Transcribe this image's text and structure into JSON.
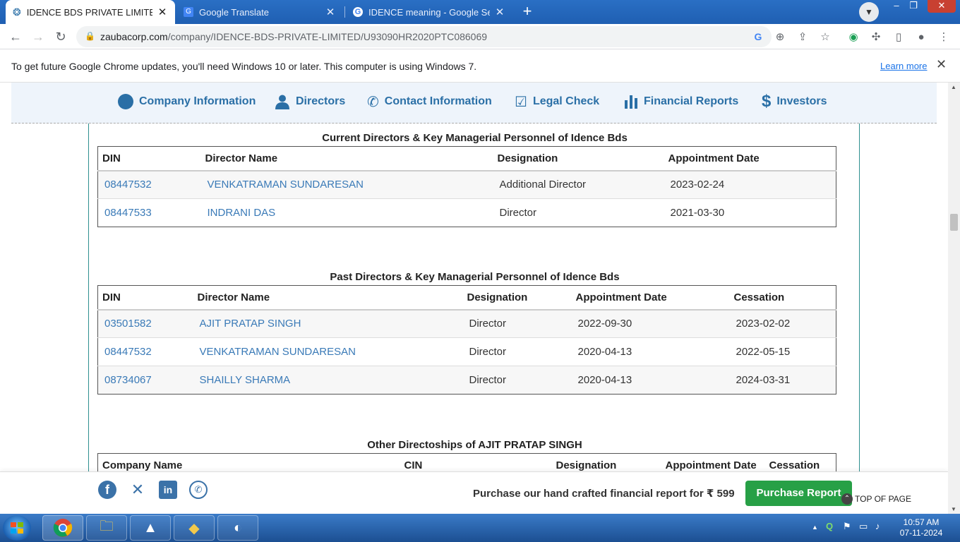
{
  "browser": {
    "tabs": [
      {
        "title": "IDENCE BDS PRIVATE LIMITED | I",
        "icon": "zauba-favicon",
        "active": true
      },
      {
        "title": "Google Translate",
        "icon": "google-translate-favicon",
        "active": false
      },
      {
        "title": "IDENCE meaning - Google Search",
        "icon": "google-favicon",
        "active": false
      }
    ],
    "close_glyph": "✕",
    "new_tab_glyph": "+",
    "url_host": "zaubacorp.com",
    "url_path": "/company/IDENCE-BDS-PRIVATE-LIMITED/U93090HR2020PTC086069"
  },
  "infobar": {
    "message": "To get future Google Chrome updates, you'll need Windows 10 or later. This computer is using Windows 7.",
    "learn_more": "Learn more"
  },
  "company_nav": [
    {
      "label": "Company Information",
      "icon": "info-circle-icon"
    },
    {
      "label": "Directors",
      "icon": "user-icon"
    },
    {
      "label": "Contact Information",
      "icon": "phone-icon"
    },
    {
      "label": "Legal Check",
      "icon": "checkbox-icon"
    },
    {
      "label": "Financial Reports",
      "icon": "bar-chart-icon"
    },
    {
      "label": "Investors",
      "icon": "dollar-icon"
    }
  ],
  "current_directors": {
    "title": "Current Directors & Key Managerial Personnel of Idence Bds",
    "headers": [
      "DIN",
      "Director Name",
      "Designation",
      "Appointment Date"
    ],
    "rows": [
      [
        "08447532",
        "VENKATRAMAN SUNDARESAN",
        "Additional Director",
        "2023-02-24"
      ],
      [
        "08447533",
        "INDRANI DAS",
        "Director",
        "2021-03-30"
      ]
    ]
  },
  "past_directors": {
    "title": "Past Directors & Key Managerial Personnel of Idence Bds",
    "headers": [
      "DIN",
      "Director Name",
      "Designation",
      "Appointment Date",
      "Cessation"
    ],
    "rows": [
      [
        "03501582",
        "AJIT PRATAP SINGH",
        "Director",
        "2022-09-30",
        "2023-02-02"
      ],
      [
        "08447532",
        "VENKATRAMAN SUNDARESAN",
        "Director",
        "2020-04-13",
        "2022-05-15"
      ],
      [
        "08734067",
        "SHAILLY SHARMA",
        "Director",
        "2020-04-13",
        "2024-03-31"
      ]
    ]
  },
  "other_directorships": {
    "title": "Other Directoships of AJIT PRATAP SINGH",
    "headers": [
      "Company Name",
      "CIN",
      "Designation",
      "Appointment Date",
      "Cessation"
    ]
  },
  "bottom_bar": {
    "promo": "Purchase our hand crafted financial report for ₹ 599",
    "buy_button": "Purchase Report",
    "top_of_page": "TOP OF PAGE",
    "social": [
      "facebook-icon",
      "x-twitter-icon",
      "linkedin-icon",
      "whatsapp-icon"
    ]
  },
  "taskbar": {
    "time": "10:57 AM",
    "date": "07-11-2024"
  },
  "colors": {
    "link": "#3a7ab7",
    "nav_text": "#2a6fa6",
    "buy_button": "#27a046",
    "chrome_blue": "#1f5fb2"
  }
}
